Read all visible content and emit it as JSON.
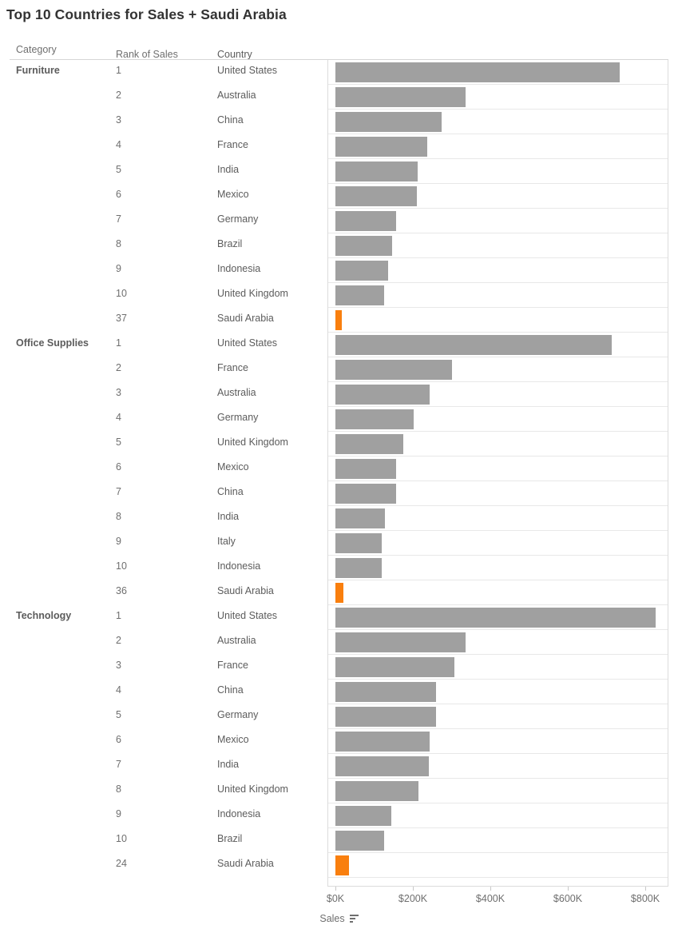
{
  "title": "Top 10 Countries for Sales + Saudi Arabia",
  "columns": {
    "category": "Category",
    "rank": "Rank of Sales",
    "country": "Country"
  },
  "axis": {
    "title": "Sales",
    "sort_icon": "sort-descending-icon",
    "ticks": [
      "$0K",
      "$200K",
      "$400K",
      "$600K",
      "$800K"
    ]
  },
  "colors": {
    "bar": "#a0a0a0",
    "highlight": "#f97f0e",
    "title": "#333333",
    "text": "#5c5c5c"
  },
  "chart_data": {
    "type": "bar",
    "title": "Top 10 Countries for Sales + Saudi Arabia",
    "xlabel": "Sales",
    "ylabel": "",
    "orientation": "horizontal",
    "xlim": [
      0,
      860000
    ],
    "xticks": [
      0,
      200000,
      400000,
      600000,
      800000
    ],
    "xticklabels": [
      "$0K",
      "$200K",
      "$400K",
      "$600K",
      "$800K"
    ],
    "grid": false,
    "legend": false,
    "highlight_color": "#f97f0e",
    "bar_color": "#a0a0a0",
    "highlight_country": "Saudi Arabia",
    "panels": [
      {
        "category": "Furniture",
        "rows": [
          {
            "rank": "1",
            "country": "United States",
            "value": 734000,
            "highlight": false
          },
          {
            "rank": "2",
            "country": "Australia",
            "value": 336000,
            "highlight": false
          },
          {
            "rank": "3",
            "country": "China",
            "value": 274000,
            "highlight": false
          },
          {
            "rank": "4",
            "country": "France",
            "value": 237000,
            "highlight": false
          },
          {
            "rank": "5",
            "country": "India",
            "value": 212000,
            "highlight": false
          },
          {
            "rank": "6",
            "country": "Mexico",
            "value": 211000,
            "highlight": false
          },
          {
            "rank": "7",
            "country": "Germany",
            "value": 157000,
            "highlight": false
          },
          {
            "rank": "8",
            "country": "Brazil",
            "value": 146000,
            "highlight": false
          },
          {
            "rank": "9",
            "country": "Indonesia",
            "value": 136000,
            "highlight": false
          },
          {
            "rank": "10",
            "country": "United Kingdom",
            "value": 126000,
            "highlight": false
          },
          {
            "rank": "37",
            "country": "Saudi Arabia",
            "value": 17000,
            "highlight": true
          }
        ]
      },
      {
        "category": "Office Supplies",
        "rows": [
          {
            "rank": "1",
            "country": "United States",
            "value": 713000,
            "highlight": false
          },
          {
            "rank": "2",
            "country": "France",
            "value": 301000,
            "highlight": false
          },
          {
            "rank": "3",
            "country": "Australia",
            "value": 243000,
            "highlight": false
          },
          {
            "rank": "4",
            "country": "Germany",
            "value": 202000,
            "highlight": false
          },
          {
            "rank": "5",
            "country": "United Kingdom",
            "value": 175000,
            "highlight": false
          },
          {
            "rank": "6",
            "country": "Mexico",
            "value": 157000,
            "highlight": false
          },
          {
            "rank": "7",
            "country": "China",
            "value": 157000,
            "highlight": false
          },
          {
            "rank": "8",
            "country": "India",
            "value": 128000,
            "highlight": false
          },
          {
            "rank": "9",
            "country": "Italy",
            "value": 120000,
            "highlight": false
          },
          {
            "rank": "10",
            "country": "Indonesia",
            "value": 119000,
            "highlight": false
          },
          {
            "rank": "36",
            "country": "Saudi Arabia",
            "value": 21000,
            "highlight": true
          }
        ]
      },
      {
        "category": "Technology",
        "rows": [
          {
            "rank": "1",
            "country": "United States",
            "value": 827000,
            "highlight": false
          },
          {
            "rank": "2",
            "country": "Australia",
            "value": 336000,
            "highlight": false
          },
          {
            "rank": "3",
            "country": "France",
            "value": 307000,
            "highlight": false
          },
          {
            "rank": "4",
            "country": "China",
            "value": 260000,
            "highlight": false
          },
          {
            "rank": "5",
            "country": "Germany",
            "value": 259000,
            "highlight": false
          },
          {
            "rank": "6",
            "country": "Mexico",
            "value": 243000,
            "highlight": false
          },
          {
            "rank": "7",
            "country": "India",
            "value": 241000,
            "highlight": false
          },
          {
            "rank": "8",
            "country": "United Kingdom",
            "value": 214000,
            "highlight": false
          },
          {
            "rank": "9",
            "country": "Indonesia",
            "value": 144000,
            "highlight": false
          },
          {
            "rank": "10",
            "country": "Brazil",
            "value": 126000,
            "highlight": false
          },
          {
            "rank": "24",
            "country": "Saudi Arabia",
            "value": 35000,
            "highlight": true
          }
        ]
      }
    ]
  }
}
